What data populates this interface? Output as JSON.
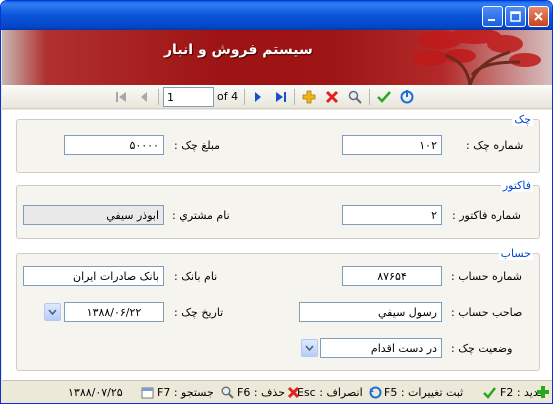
{
  "banner": {
    "title": "سیستم فروش و انبار"
  },
  "navigator": {
    "position": "1",
    "of_total": "of 4"
  },
  "check_section": {
    "legend": "چک",
    "check_number_label": "شماره چک :",
    "check_number_value": "۱۰۲",
    "check_amount_label": "مبلغ چک :",
    "check_amount_value": "۵۰۰۰۰"
  },
  "invoice_section": {
    "legend": "فاکتور",
    "invoice_number_label": "شماره فاکتور :",
    "invoice_number_value": "۲",
    "customer_name_label": "نام مشتري :",
    "customer_name_value": "ابوذر سیفي"
  },
  "account_section": {
    "legend": "حساب",
    "account_number_label": "شماره حساب :",
    "account_number_value": "۸۷۶۵۴",
    "bank_name_label": "نام بانک :",
    "bank_name_value": "بانک صادرات ایران",
    "account_owner_label": "صاحب حساب :",
    "account_owner_value": "رسول سیفي",
    "check_date_label": "تاریخ چک :",
    "check_date_value": "۱۳۸۸/۰۶/۲۲",
    "check_status_label": "وضعیت چک :",
    "check_status_value": "در دست اقدام"
  },
  "statusbar": {
    "new": "F2 : جدید",
    "save": "F5 : ثبت تغییرات",
    "cancel": "Esc : انصراف",
    "delete": "F6 : حذف",
    "search": "F7 : جستجو",
    "date": "۱۳۸۸/۰۷/۲۵"
  },
  "colors": {
    "accent": "#0046d5",
    "banner": "#9e1313",
    "titlebar": "#0a55d8"
  }
}
